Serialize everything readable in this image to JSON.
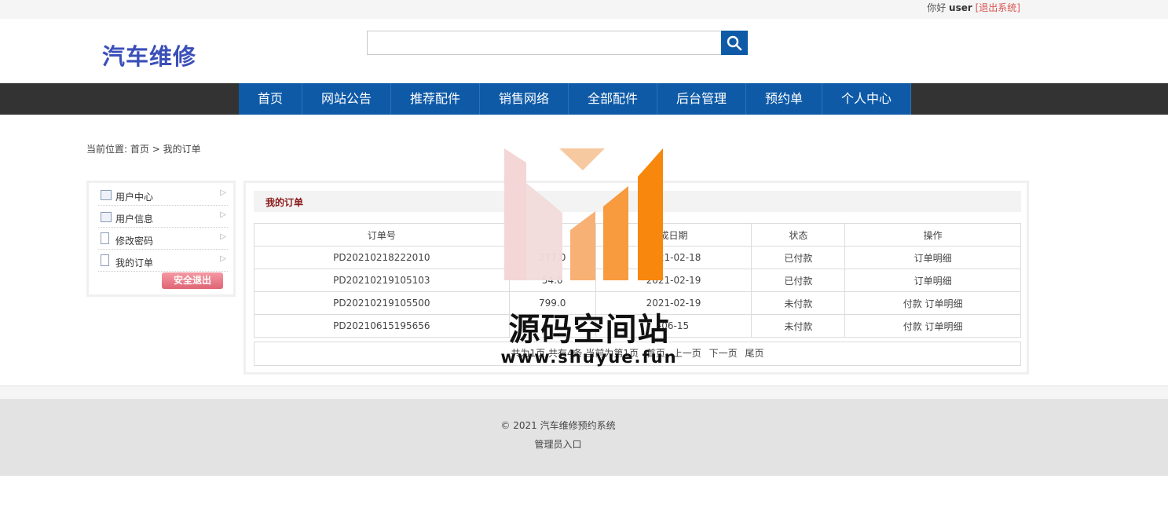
{
  "topbar": {
    "greeting": "你好",
    "username": "user",
    "logout_link": "[退出系统]"
  },
  "header": {
    "logo": "汽车维修",
    "search_placeholder": ""
  },
  "nav": {
    "items": [
      "首页",
      "网站公告",
      "推荐配件",
      "销售网络",
      "全部配件",
      "后台管理",
      "预约单",
      "个人中心"
    ]
  },
  "breadcrumb": {
    "prefix": "当前位置:",
    "home": "首页",
    "separator": ">",
    "current": "我的订单"
  },
  "sidebar": {
    "items": [
      "用户中心",
      "用户信息",
      "修改密码",
      "我的订单"
    ],
    "logout_button": "安全退出"
  },
  "orders": {
    "title": "我的订单",
    "columns": [
      "订单号",
      "",
      "成日期",
      "状态",
      "操作"
    ],
    "rows": [
      {
        "order_no": "PD20210218222010",
        "amount": "277.0",
        "date": "2021-02-18",
        "status": "已付款",
        "pay": "",
        "detail": "订单明细"
      },
      {
        "order_no": "PD20210219105103",
        "amount": "54.0",
        "date": "2021-02-19",
        "status": "已付款",
        "pay": "",
        "detail": "订单明细"
      },
      {
        "order_no": "PD20210219105500",
        "amount": "799.0",
        "date": "2021-02-19",
        "status": "未付款",
        "pay": "付款",
        "detail": "订单明细"
      },
      {
        "order_no": "PD20210615195656",
        "amount": "",
        "date": "-06-15",
        "status": "未付款",
        "pay": "付款",
        "detail": "订单明细"
      }
    ]
  },
  "pager": {
    "summary": "共为1页 共有4条 当前为第1页",
    "first": "首页",
    "prev": "上一页",
    "next": "下一页",
    "last": "尾页"
  },
  "footer": {
    "copyright": "© 2021 汽车维修预约系统",
    "admin_link": "管理员入口"
  },
  "watermark": {
    "title": "源码空间站",
    "url": "www.shuyue.fun"
  },
  "colors": {
    "nav_blue": "#0e5aa7",
    "nav_dark": "#333333",
    "logo": "#3b4fb8",
    "title_red": "#8b1a1a",
    "logout_red": "#d9534f"
  }
}
